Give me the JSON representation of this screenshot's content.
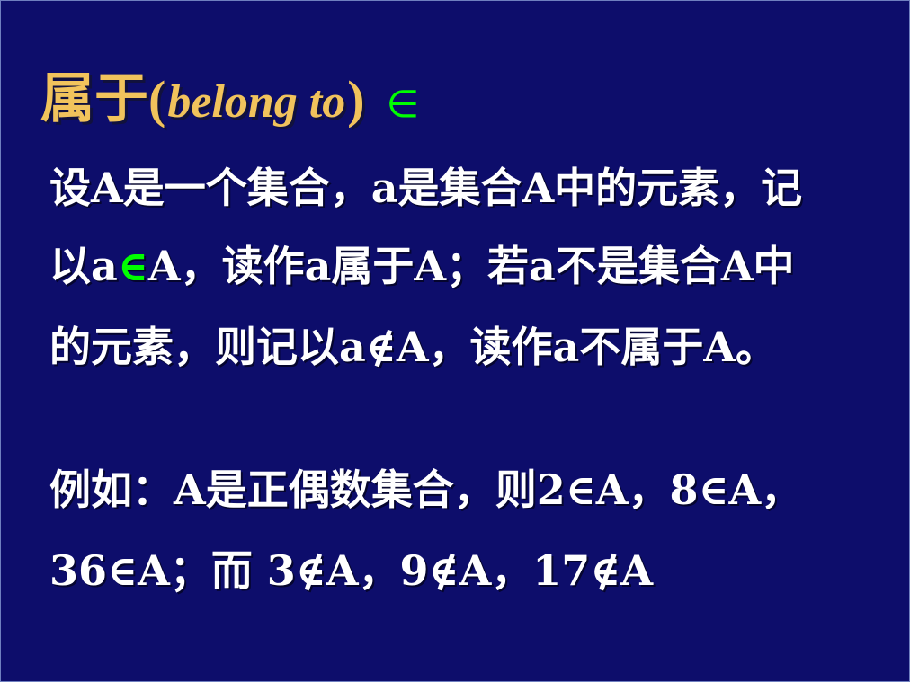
{
  "title": {
    "chinese": "属于",
    "open_paren": "(",
    "english": "belong to",
    "close_paren": ")",
    "symbol": "∈"
  },
  "paragraphs": {
    "line1": "设A是一个集合，a是集合A中的元素，记",
    "line2_part1": "以a",
    "line2_symbol": "∈",
    "line2_part2": "A，读作a属于A；若a不是集合A中",
    "line3": "的元素，则记以a∉A，读作a不属于A。",
    "line4": "例如：A是正偶数集合，则2∈A，8∈A，",
    "line5": "36∈A；而 3∉A，9∉A，17∉A"
  },
  "colors": {
    "background": "#0d0d6b",
    "title": "#f1c35c",
    "text": "#ffffff",
    "symbol": "#00ff00"
  }
}
